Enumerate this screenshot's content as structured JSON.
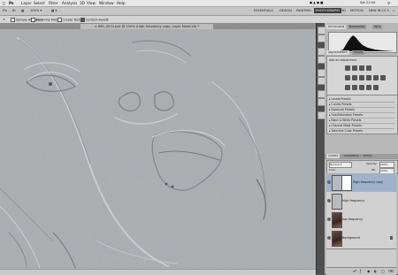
{
  "menubar": {
    "app_icon": "photoshop-icon",
    "items": [
      "Ps",
      "Layer",
      "Select",
      "Filter",
      "Analysis",
      "3D",
      "View",
      "Window",
      "Help"
    ],
    "time": "Sat 22:04"
  },
  "appbar": {
    "workspaces": [
      "ESSENTIALS",
      "DESIGN",
      "PAINTING",
      "PHOTOGRAPHY",
      "3D",
      "MOTION",
      "NEW IN CS 5"
    ],
    "active_workspace": "PHOTOGRAPHY"
  },
  "options": {
    "sample_all_layers": "Sample All Layers",
    "proximity_match": "Proximity Match",
    "create_texture": "Create Texture",
    "content_aware": "Content-Aware"
  },
  "document": {
    "tab_title": "IMG_0074.psd @ 100% (High frequency copy, Layer Mask/16) *"
  },
  "panels": {
    "top_tabs": [
      "HISTOGRAM",
      "NAVIGATOR",
      "INFO"
    ],
    "adjust_tabs": [
      "ADJUSTMENTS",
      "MASKS"
    ],
    "adjust_heading": "Add an adjustment",
    "presets": [
      "Levels Presets",
      "Curves Presets",
      "Exposure Presets",
      "Hue/Saturation Presets",
      "Black & White Presets",
      "Channel Mixer Presets",
      "Selective Color Presets"
    ],
    "layer_tabs": [
      "LAYERS",
      "CHANNELS",
      "PATHS"
    ],
    "blend_mode": "Normal",
    "opacity_label": "Opacity:",
    "opacity_value": "100%",
    "fill_label": "Fill:",
    "fill_value": "100%",
    "lock_label": "Lock:"
  },
  "layers": [
    {
      "name": "High frequency copy",
      "selected": true
    },
    {
      "name": "High frequency",
      "selected": false
    },
    {
      "name": "low frequency",
      "selected": false
    },
    {
      "name": "Background",
      "selected": false
    }
  ]
}
